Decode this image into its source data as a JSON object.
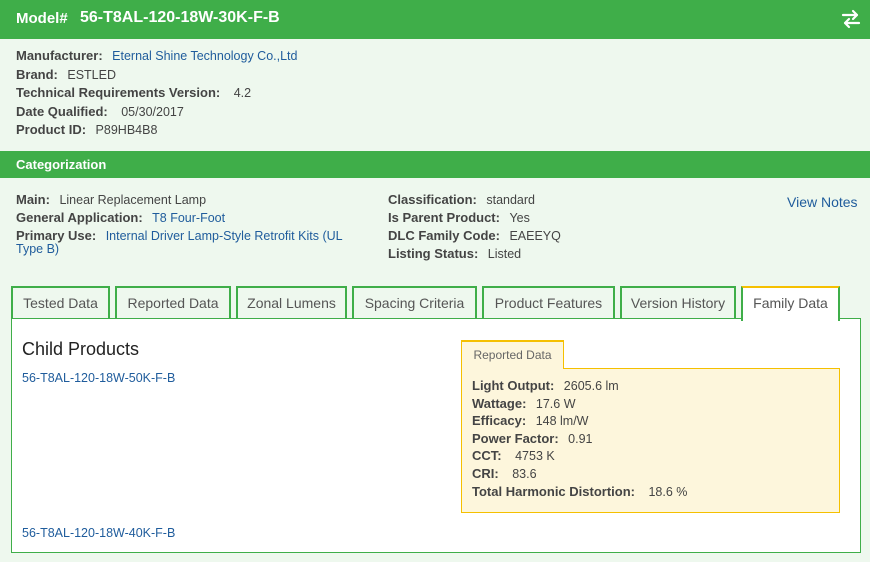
{
  "header": {
    "model_label": "Model#",
    "model_value": "56-T8AL-120-18W-30K-F-B",
    "swap_icon": "swap-arrows-icon",
    "color": "#3fae49"
  },
  "info": {
    "manufacturer_label": "Manufacturer:",
    "manufacturer_value": "Eternal Shine Technology Co.,Ltd",
    "brand_label": "Brand:",
    "brand_value": "ESTLED",
    "tech_req_label": "Technical Requirements Version:",
    "tech_req_value": "4.2",
    "date_label": "Date Qualified:",
    "date_value": "05/30/2017",
    "product_id_label": "Product ID:",
    "product_id_value": "P89HB4B8"
  },
  "categorization": {
    "title": "Categorization",
    "main_label": "Main:",
    "main_value": "Linear Replacement Lamp",
    "general_app_label": "General Application:",
    "general_app_value": "T8 Four-Foot",
    "primary_use_label": "Primary Use:",
    "primary_use_value_line1": "Internal Driver Lamp-Style Retrofit Kits (UL",
    "primary_use_value_line2": "Type B)",
    "classification_label": "Classification:",
    "classification_value": "standard",
    "is_parent_label": "Is Parent Product:",
    "is_parent_value": "Yes",
    "family_code_label": "DLC Family Code:",
    "family_code_value": "EAEEYQ",
    "listing_status_label": "Listing Status:",
    "listing_status_value": "Listed",
    "view_notes": "View Notes"
  },
  "tabs": [
    {
      "label": "Tested Data"
    },
    {
      "label": "Reported Data"
    },
    {
      "label": "Zonal Lumens"
    },
    {
      "label": "Spacing Criteria"
    },
    {
      "label": "Product Features"
    },
    {
      "label": "Version History"
    },
    {
      "label": "Family Data",
      "active": true
    }
  ],
  "family": {
    "title": "Child Products",
    "children": [
      "56-T8AL-120-18W-50K-F-B",
      "56-T8AL-120-18W-40K-F-B"
    ]
  },
  "reported": {
    "tab_label": "Reported Data",
    "light_output_label": "Light Output:",
    "light_output_value": "2605.6 lm",
    "wattage_label": "Wattage:",
    "wattage_value": "17.6 W",
    "efficacy_label": "Efficacy:",
    "efficacy_value": "148 lm/W",
    "power_factor_label": "Power Factor:",
    "power_factor_value": "0.91",
    "cct_label": "CCT:",
    "cct_value": "4753 K",
    "cri_label": "CRI:",
    "cri_value": "83.6",
    "thd_label": "Total Harmonic Distortion:",
    "thd_value": "18.6 %"
  }
}
